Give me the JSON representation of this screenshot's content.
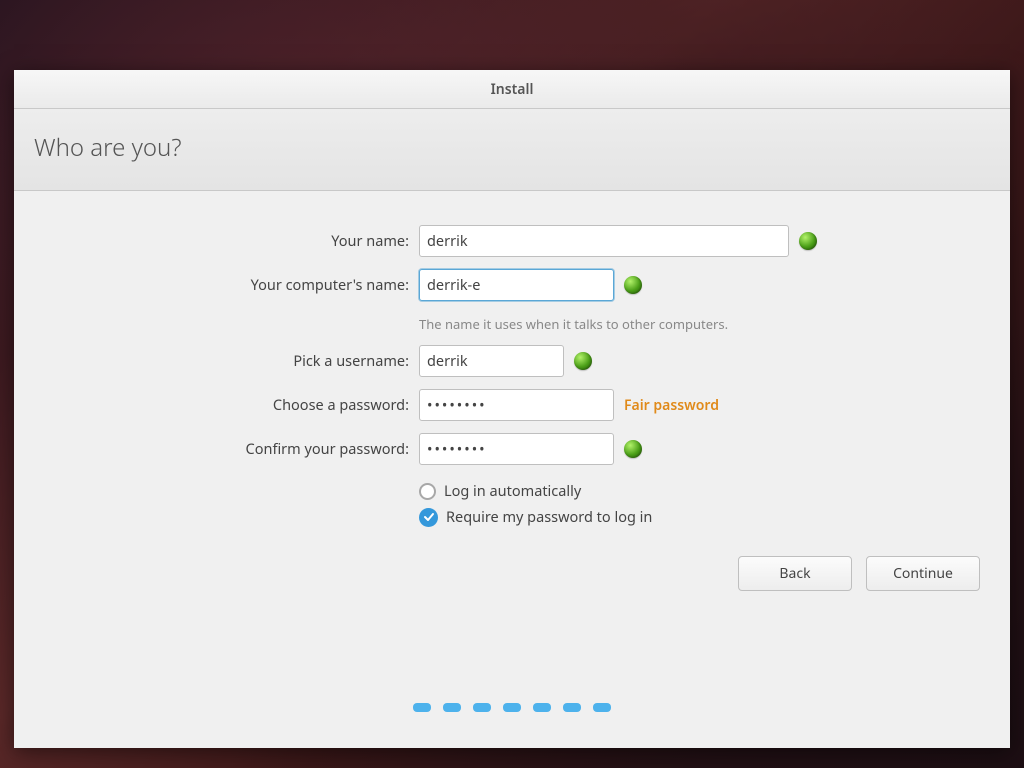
{
  "window": {
    "title": "Install"
  },
  "page": {
    "heading": "Who are you?"
  },
  "form": {
    "name": {
      "label": "Your name:",
      "value": "derrik"
    },
    "computer": {
      "label": "Your computer's name:",
      "value": "derrik-e",
      "hint": "The name it uses when it talks to other computers."
    },
    "username": {
      "label": "Pick a username:",
      "value": "derrik"
    },
    "password": {
      "label": "Choose a password:",
      "value": "••••••••",
      "strength": "Fair password"
    },
    "confirm": {
      "label": "Confirm your password:",
      "value": "••••••••"
    },
    "login_options": {
      "auto": "Log in automatically",
      "require": "Require my password to log in"
    }
  },
  "buttons": {
    "back": "Back",
    "continue": "Continue"
  },
  "colors": {
    "accent": "#3498db",
    "strength_warn": "#e08a1a",
    "status_ok": "#4a9e17"
  },
  "progress": {
    "steps": 7
  }
}
